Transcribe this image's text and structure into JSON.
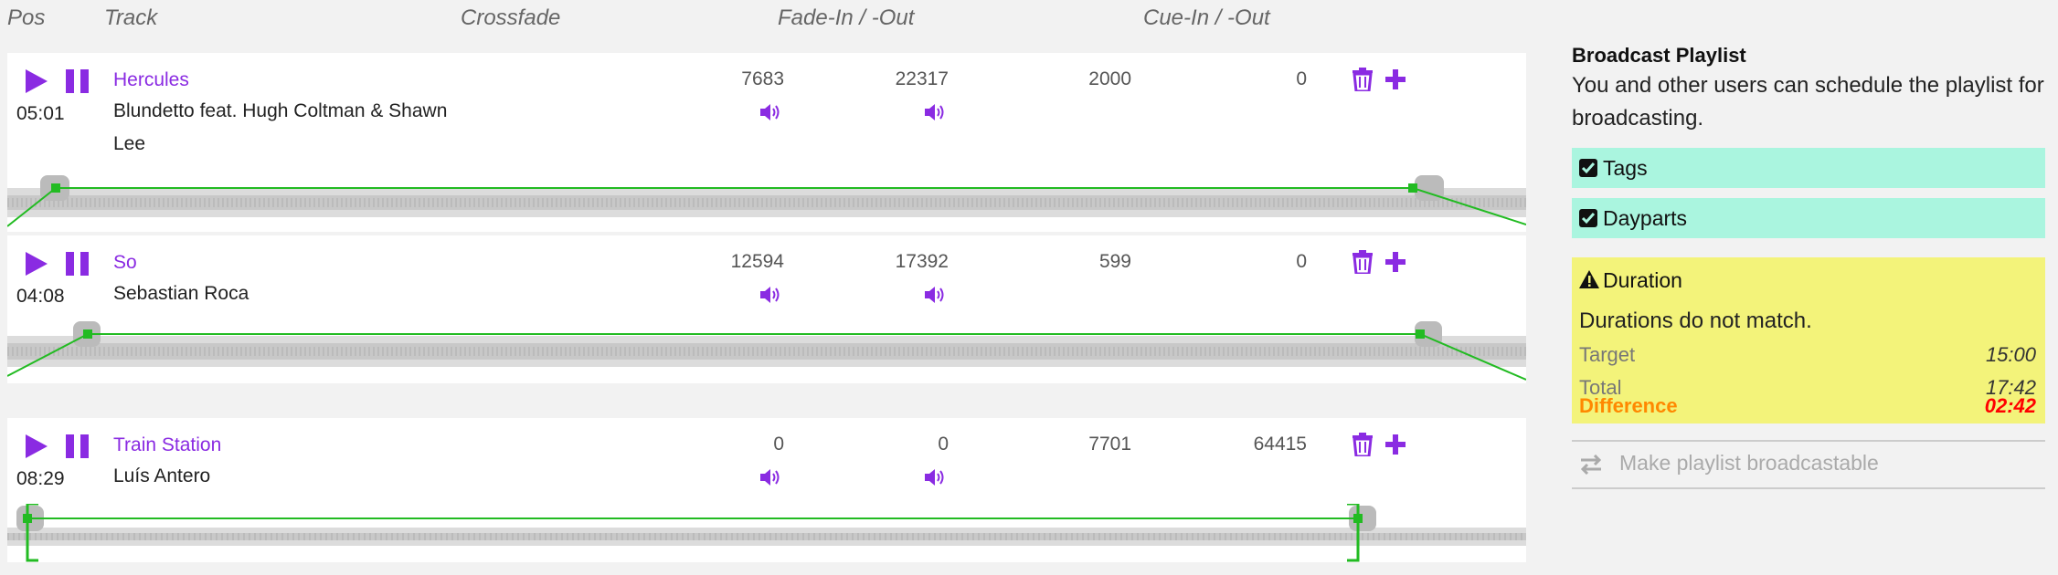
{
  "headers": {
    "pos": "Pos",
    "track": "Track",
    "crossfade": "Crossfade",
    "fade": "Fade-In / -Out",
    "cue": "Cue-In / -Out"
  },
  "tracks": [
    {
      "title": "Hercules",
      "time": "05:01",
      "artist": "Blundetto feat. Hugh Coltman & Shawn Lee",
      "fade_in": "7683",
      "fade_out": "22317",
      "cue_in": "2000",
      "cue_out": "0"
    },
    {
      "title": "So",
      "time": "04:08",
      "artist": "Sebastian Roca",
      "fade_in": "12594",
      "fade_out": "17392",
      "cue_in": "599",
      "cue_out": "0"
    },
    {
      "title": "Train Station",
      "time": "08:29",
      "artist": "Luís Antero",
      "fade_in": "0",
      "fade_out": "0",
      "cue_in": "7701",
      "cue_out": "64415"
    }
  ],
  "sidebar": {
    "title": "Broadcast Playlist",
    "description": "You and other users can schedule the playlist for broadcasting.",
    "tags_label": "Tags",
    "dayparts_label": "Dayparts",
    "duration": {
      "title": "Duration",
      "message": "Durations do not match.",
      "target_label": "Target",
      "target_value": "15:00",
      "total_label": "Total",
      "total_value": "17:42",
      "difference_label": "Difference",
      "difference_value": "02:42"
    },
    "make_broadcastable_label": "Make playlist broadcastable"
  },
  "colors": {
    "accent": "#8a2be2",
    "envelope": "#22bb22",
    "check_bg": "#aaf5df",
    "warning_bg": "#f3f37a",
    "difference_label": "#ff8800",
    "difference_value": "#ff0000"
  },
  "icons": [
    "play-icon",
    "pause-icon",
    "speaker-icon",
    "trash-icon",
    "plus-icon",
    "checkbox-icon",
    "warning-icon",
    "swap-icon"
  ]
}
